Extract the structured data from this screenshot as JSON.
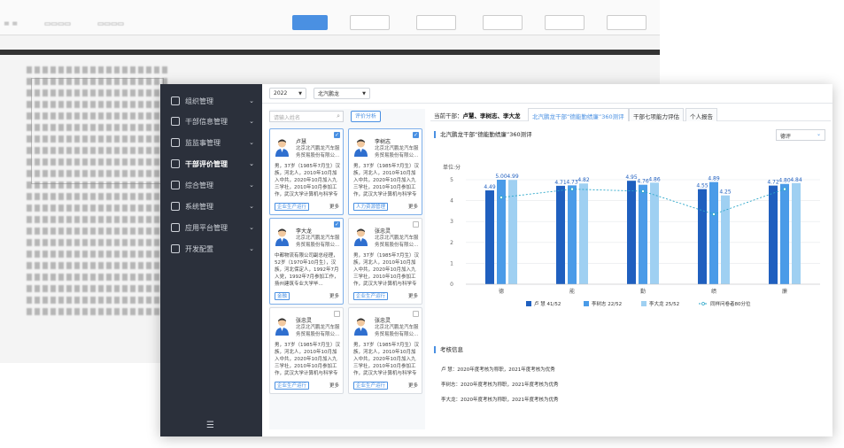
{
  "sidebar": {
    "items": [
      {
        "label": "组织管理",
        "icon": "org-icon"
      },
      {
        "label": "干部信息管理",
        "icon": "people-icon"
      },
      {
        "label": "监监事管理",
        "icon": "supervise-icon"
      },
      {
        "label": "干部评价管理",
        "icon": "evaluate-icon"
      },
      {
        "label": "综合管理",
        "icon": "grid-icon"
      },
      {
        "label": "系统管理",
        "icon": "settings-icon"
      },
      {
        "label": "应用平台管理",
        "icon": "platform-icon"
      },
      {
        "label": "开发配置",
        "icon": "dev-config-icon"
      }
    ],
    "active_index": 3,
    "collapse_glyph": "☰"
  },
  "filters": {
    "year": "2022",
    "org": "北汽鹏龙"
  },
  "left": {
    "search_placeholder": "请输入姓名",
    "eval_button": "评价分析",
    "cards": [
      {
        "name": "卢慧",
        "company": "北京北汽鹏龙汽车服务贸易股份有限公...",
        "bio": "男，37岁（1985年7月生）汉族，河北人，2010年10月加入中共，2020年10月加入九三学社，2010年10月参加工作，武汉大学计算机与科学专业硕...",
        "tag": "企业生产运行",
        "more": "更多",
        "selected": true
      },
      {
        "name": "李树志",
        "company": "北京北汽鹏龙汽车服务贸易股份有限公...",
        "bio": "男，37岁（1985年7月生）汉族，河北人，2010年10月加入中共，2020年10月加入九三学社，2010年10月参加工作，武汉大学计算机与科学专业硕...",
        "tag": "人力资源管理",
        "more": "更多",
        "selected": true
      },
      {
        "name": "李大龙",
        "company": "北京北汽鹏龙汽车服务贸易股份有限公...",
        "bio": "中都物流有限公司副总经理，52岁（1970年10月生），汉族，河北保定人，1992年7月入党，1992年7月参加工作，扬州建筑专业大学毕...",
        "tag": "金融",
        "more": "更多",
        "selected": true
      },
      {
        "name": "张忠灵",
        "company": "北京北汽鹏龙汽车服务贸易股份有限公...",
        "bio": "男，37岁（1985年7月生）汉族，河北人，2010年10月加入中共，2020年10月加入九三学社，2010年10月参加工作，武汉大学计算机与科学专业硕...",
        "tag": "企业生产运行",
        "more": "更多",
        "selected": false
      },
      {
        "name": "张忠灵",
        "company": "北京北汽鹏龙汽车服务贸易股份有限公...",
        "bio": "男，37岁（1985年7月生）汉族，河北人，2010年10月加入中共，2020年10月加入九三学社，2010年10月参加工作，武汉大学计算机与科学专业硕...",
        "tag": "企业生产运行",
        "more": "更多",
        "selected": false
      },
      {
        "name": "张忠灵",
        "company": "北京北汽鹏龙汽车服务贸易股份有限公...",
        "bio": "男，37岁（1985年7月生）汉族，河北人，2010年10月加入中共，2020年10月加入九三学社，2010年10月参加工作，武汉大学计算机与科学专业硕...",
        "tag": "企业生产运行",
        "more": "更多",
        "selected": false
      }
    ]
  },
  "right": {
    "current_label": "当前干部：",
    "current_names": "卢慧、李树志、李大龙",
    "tabs": [
      "北汽鹏龙干部“德能勤绩廉”360测评",
      "干部七项能力评估",
      "个人报告"
    ],
    "active_tab": 0,
    "chart_title": "北汽鹏龙干部“德能勤绩廉”360测评",
    "dimension_select": "德评",
    "info_title": "考核信息",
    "info_lines": [
      "卢 慧：2020年度考核为称职，2021年度考核为优秀",
      "李树志：2020年度考核为称职，2021年度考核为优秀",
      "李大龙：2020年度考核为称职，2021年度考核为优秀"
    ]
  },
  "chart_data": {
    "type": "bar",
    "ylabel": "单位:分",
    "ylim": [
      0,
      5
    ],
    "yticks": [
      0,
      1,
      2,
      3,
      4,
      5
    ],
    "categories": [
      "德",
      "能",
      "勤",
      "绩",
      "廉"
    ],
    "series": [
      {
        "name": "卢 慧",
        "rank": "41/52",
        "color": "#1f5fbf",
        "values": [
          4.49,
          4.71,
          4.95,
          4.55,
          4.72
        ]
      },
      {
        "name": "李树志",
        "rank": "22/52",
        "color": "#4a9be8",
        "values": [
          5.0,
          4.73,
          4.76,
          4.89,
          4.8
        ]
      },
      {
        "name": "李大龙",
        "rank": "25/52",
        "color": "#9fd0f2",
        "values": [
          4.99,
          4.82,
          4.86,
          4.25,
          4.84
        ]
      }
    ],
    "line_series": {
      "name": "同样问卷者80分位",
      "color": "#2aa6c9",
      "values": [
        4.15,
        4.55,
        4.45,
        3.35,
        4.55
      ]
    },
    "legend_position": "bottom",
    "grid": true
  }
}
